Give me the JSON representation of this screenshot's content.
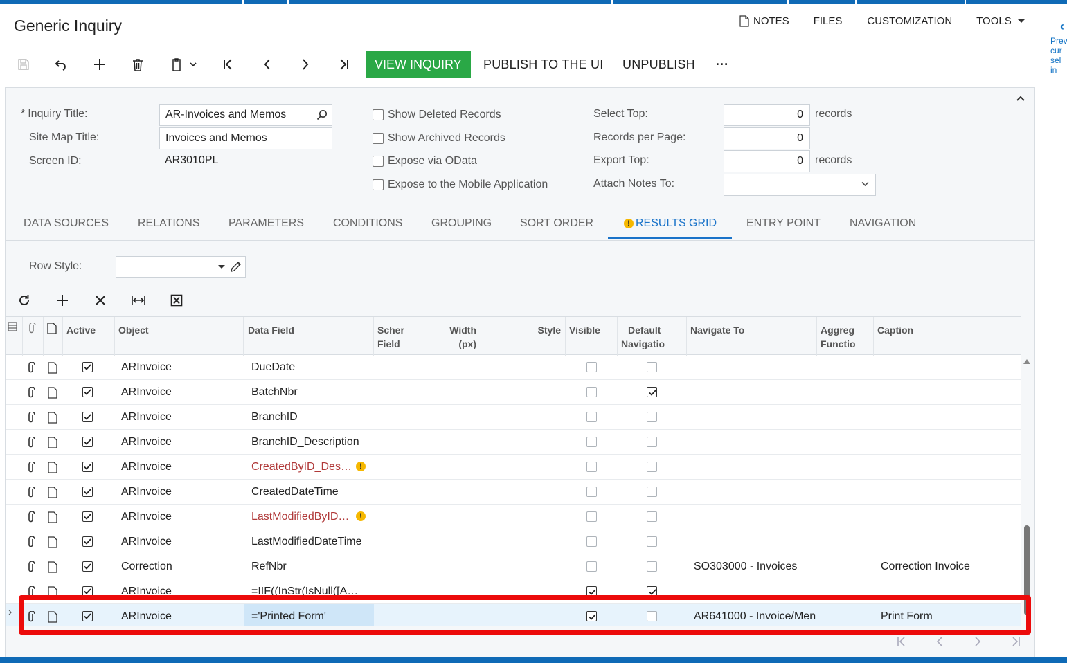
{
  "page": {
    "title": "Generic Inquiry"
  },
  "top_links": {
    "notes": "NOTES",
    "files": "FILES",
    "customization": "CUSTOMIZATION",
    "tools": "TOOLS"
  },
  "toolbar": {
    "view_inquiry": "VIEW INQUIRY",
    "publish": "PUBLISH TO THE UI",
    "unpublish": "UNPUBLISH",
    "more": "···",
    "view_inquiry_color": "#2aa846"
  },
  "right_panel": {
    "lines": [
      "Prev",
      "cur",
      "sel",
      "in"
    ]
  },
  "form": {
    "inquiry_title_label": "Inquiry Title:",
    "inquiry_title_value": "AR-Invoices and Memos",
    "site_map_title_label": "Site Map Title:",
    "site_map_title_value": "Invoices and Memos",
    "screen_id_label": "Screen ID:",
    "screen_id_value": "AR3010PL",
    "show_deleted": "Show Deleted Records",
    "show_archived": "Show Archived Records",
    "expose_odata": "Expose via OData",
    "expose_mobile": "Expose to the Mobile Application",
    "select_top_label": "Select Top:",
    "select_top_value": "0",
    "select_top_unit": "records",
    "records_per_page_label": "Records per Page:",
    "records_per_page_value": "0",
    "export_top_label": "Export Top:",
    "export_top_value": "0",
    "export_top_unit": "records",
    "attach_notes_label": "Attach Notes To:",
    "attach_notes_value": ""
  },
  "tabs": [
    "DATA SOURCES",
    "RELATIONS",
    "PARAMETERS",
    "CONDITIONS",
    "GROUPING",
    "SORT ORDER",
    "RESULTS GRID",
    "ENTRY POINT",
    "NAVIGATION"
  ],
  "active_tab": "RESULTS GRID",
  "row_style": {
    "label": "Row Style:",
    "value": ""
  },
  "grid": {
    "columns": {
      "active": "Active",
      "object": "Object",
      "data_field": "Data Field",
      "schema_field_1": "Scher",
      "schema_field_2": "Field",
      "width_1": "Width",
      "width_2": "(px)",
      "style": "Style",
      "visible": "Visible",
      "default_nav_1": "Default",
      "default_nav_2": "Navigatio",
      "navigate_to": "Navigate To",
      "aggregate_1": "Aggreg",
      "aggregate_2": "Functio",
      "caption": "Caption"
    },
    "rows": [
      {
        "active": true,
        "object": "ARInvoice",
        "data_field": "DueDate",
        "error": false,
        "visible": false,
        "default_nav": false,
        "navigate_to": "",
        "caption": ""
      },
      {
        "active": true,
        "object": "ARInvoice",
        "data_field": "BatchNbr",
        "error": false,
        "visible": false,
        "default_nav": true,
        "navigate_to": "",
        "caption": ""
      },
      {
        "active": true,
        "object": "ARInvoice",
        "data_field": "BranchID",
        "error": false,
        "visible": false,
        "default_nav": false,
        "navigate_to": "",
        "caption": ""
      },
      {
        "active": true,
        "object": "ARInvoice",
        "data_field": "BranchID_Description",
        "error": false,
        "visible": false,
        "default_nav": false,
        "navigate_to": "",
        "caption": ""
      },
      {
        "active": true,
        "object": "ARInvoice",
        "data_field": "CreatedByID_Des…",
        "error": true,
        "visible": false,
        "default_nav": false,
        "navigate_to": "",
        "caption": ""
      },
      {
        "active": true,
        "object": "ARInvoice",
        "data_field": "CreatedDateTime",
        "error": false,
        "visible": false,
        "default_nav": false,
        "navigate_to": "",
        "caption": ""
      },
      {
        "active": true,
        "object": "ARInvoice",
        "data_field": "LastModifiedByID…",
        "error": true,
        "visible": false,
        "default_nav": false,
        "navigate_to": "",
        "caption": ""
      },
      {
        "active": true,
        "object": "ARInvoice",
        "data_field": "LastModifiedDateTime",
        "error": false,
        "visible": false,
        "default_nav": false,
        "navigate_to": "",
        "caption": ""
      },
      {
        "active": true,
        "object": "Correction",
        "data_field": "RefNbr",
        "error": false,
        "visible": false,
        "default_nav": false,
        "navigate_to": "SO303000 - Invoices",
        "caption": "Correction Invoice"
      },
      {
        "active": true,
        "object": "ARInvoice",
        "data_field": "=IIF((InStr(IsNull([A…",
        "error": false,
        "visible": true,
        "default_nav": true,
        "navigate_to": "",
        "caption": ""
      },
      {
        "active": true,
        "object": "ARInvoice",
        "data_field": "='Printed Form'",
        "error": false,
        "visible": true,
        "default_nav": false,
        "navigate_to": "AR641000 - Invoice/Men",
        "caption": "Print Form",
        "selected": true
      }
    ]
  },
  "colors": {
    "brand_blue": "#0f6ab6",
    "tab_active": "#1a73c9",
    "error_text": "#b03838",
    "warning": "#f6b800",
    "highlight_box": "#ec0b0b"
  }
}
